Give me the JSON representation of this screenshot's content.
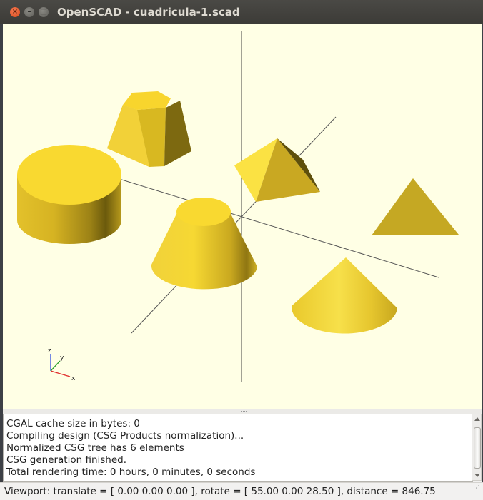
{
  "window": {
    "title": "OpenSCAD - cuadricula-1.scad",
    "buttons": {
      "close": "×",
      "minimize": "–",
      "maximize": "□"
    }
  },
  "viewport": {
    "background": "#ffffe5",
    "object_color": "#f6d833",
    "axes": {
      "x": "x",
      "y": "y",
      "z": "z"
    },
    "objects": [
      "cylinder",
      "hexagonal-frustum",
      "pyramid",
      "cone-frustum",
      "triangle",
      "cone"
    ]
  },
  "console": {
    "lines": [
      "CGAL cache size in bytes: 0",
      "Compiling design (CSG Products normalization)...",
      "Normalized CSG tree has 6 elements",
      "CSG generation finished.",
      "Total rendering time: 0 hours, 0 minutes, 0 seconds"
    ]
  },
  "status": {
    "viewport_text": "Viewport: translate = [ 0.00 0.00 0.00 ], rotate = [ 55.00 0.00 28.50 ], distance = 846.75"
  }
}
